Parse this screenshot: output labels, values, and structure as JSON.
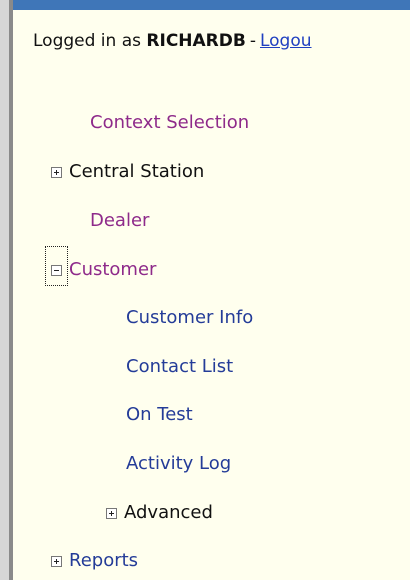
{
  "header": {
    "logged_in_prefix": "Logged in as",
    "username": "RICHARDB",
    "separator": "-",
    "logout_link": "Logou"
  },
  "nav": {
    "context_selection": "Context Selection",
    "central_station": "Central Station",
    "dealer": "Dealer",
    "customer": "Customer",
    "customer_children": {
      "customer_info": "Customer Info",
      "contact_list": "Contact List",
      "on_test": "On Test",
      "activity_log": "Activity Log",
      "advanced": "Advanced"
    },
    "reports": "Reports"
  },
  "colors": {
    "top_bar": "#3f76b8",
    "panel_bg": "#ffffee",
    "link_purple": "#8e2a8a",
    "link_blue": "#243c98"
  }
}
